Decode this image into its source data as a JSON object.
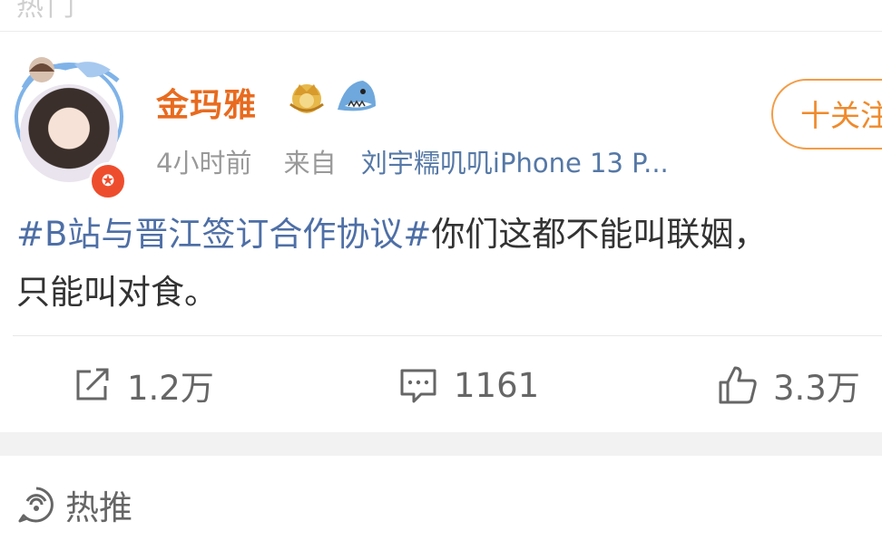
{
  "top": {
    "cut_text": "热门"
  },
  "post": {
    "username": "金玛雅",
    "time": "4小时前",
    "from_label": "来自",
    "source": "刘宇糯叽叽iPhone 13 P...",
    "follow_label": "十关注",
    "topic": "#B站与晋江签订合作协议#",
    "text_line1_rest": "你们这都不能叫联姻，",
    "text_line2": "只能叫对食。",
    "actions": {
      "repost": "1.2万",
      "comment": "1161",
      "like": "3.3万"
    },
    "icons": {
      "crown": "crown-badge-icon",
      "shark": "shark-emoji-icon",
      "verify": "star-verify-icon",
      "repost": "share-icon",
      "comment": "comment-icon",
      "like": "thumbs-up-icon",
      "hot": "hot-recommend-icon"
    }
  },
  "hot_section": {
    "label": "热推"
  },
  "colors": {
    "username": "#e86b1f",
    "topic": "#4e6fa6",
    "follow": "#f08a2b",
    "verify": "#ee4d2d"
  }
}
